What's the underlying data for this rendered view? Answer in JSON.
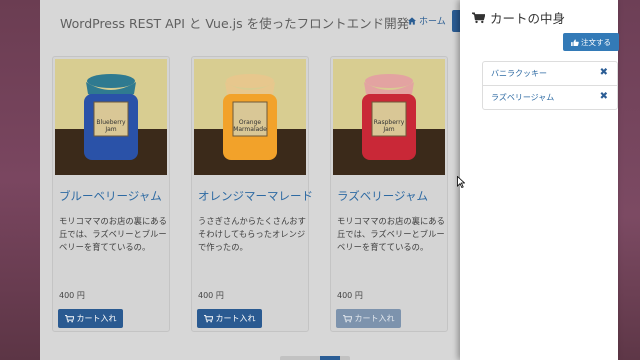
{
  "header": {
    "title": "WordPress REST API と Vue.js を使ったフロントエンド開発",
    "home_label": "ホーム"
  },
  "products": [
    {
      "name": "ブルーベリージャム",
      "description": "モリコママのお店の裏にある丘では、ラズベリーとブルーベリーを育てているの。",
      "price": "400 円",
      "button_label": "カート入れ",
      "button_disabled": false,
      "jar_label": "Blueberry\nJam",
      "jar_color": "#2a52a8",
      "lid_color": "#2f7a90"
    },
    {
      "name": "オレンジマーマレード",
      "description": "うさぎさんからたくさんおすそわけしてもらったオレンジで作ったの。",
      "price": "400 円",
      "button_label": "カート入れ",
      "button_disabled": false,
      "jar_label": "Orange\nMarmalade",
      "jar_color": "#f2a22a",
      "lid_color": "#e7c78d"
    },
    {
      "name": "ラズベリージャム",
      "description": "モリコママのお店の裏にある丘では、ラズベリーとブルーベリーを育てているの。",
      "price": "400 円",
      "button_label": "カート入れ",
      "button_disabled": true,
      "jar_label": "Raspberry\nJam",
      "jar_color": "#c92837",
      "lid_color": "#e3a3a1"
    }
  ],
  "cart": {
    "title": "カートの中身",
    "order_label": "注文する",
    "items": [
      {
        "label": "バニラクッキー"
      },
      {
        "label": "ラズベリージャム"
      }
    ]
  },
  "colors": {
    "accent": "#337ab7",
    "button": "#2a5a91",
    "link": "#2d6aa3"
  }
}
